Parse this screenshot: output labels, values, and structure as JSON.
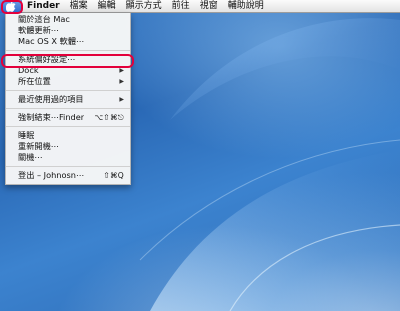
{
  "menubar": {
    "apple_icon": "apple-icon",
    "items": [
      {
        "label": "Finder",
        "bold": true
      },
      {
        "label": "檔案"
      },
      {
        "label": "編輯"
      },
      {
        "label": "顯示方式"
      },
      {
        "label": "前往"
      },
      {
        "label": "視窗"
      },
      {
        "label": "輔助說明"
      }
    ]
  },
  "apple_menu": {
    "about": "關於這台 Mac",
    "software_update": "軟體更新⋯",
    "mac_os_x_software": "Mac OS X 軟體⋯",
    "system_preferences": "系統偏好設定⋯",
    "dock": "Dock",
    "location": "所在位置",
    "recent_items": "最近使用過的項目",
    "force_quit": "強制結束⋯Finder",
    "force_quit_shortcut": "⌥⇧⌘⎋",
    "sleep": "睡眠",
    "restart": "重新開機⋯",
    "shutdown": "關機⋯",
    "logout": "登出 – Johnosn⋯",
    "logout_shortcut": "⇧⌘Q",
    "submenu_arrow": "▶"
  },
  "colors": {
    "callout": "#e3003b",
    "apple_menu_selected": "#2f6bd1"
  }
}
